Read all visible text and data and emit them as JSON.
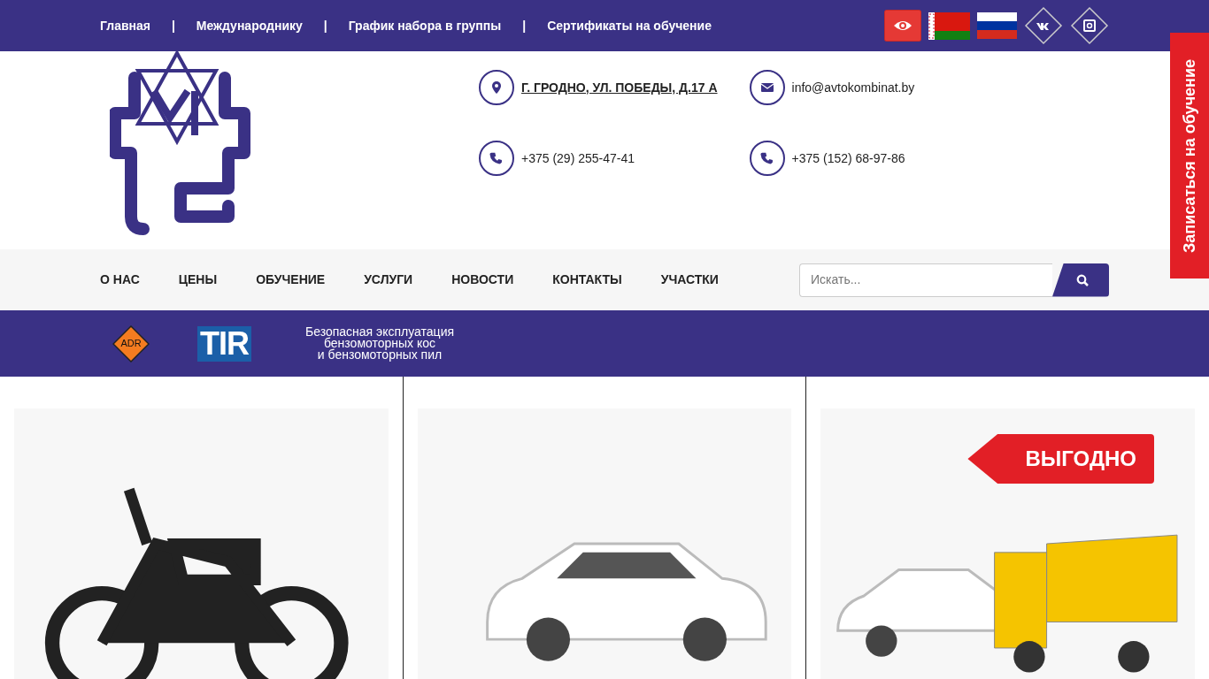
{
  "top_links": [
    "Главная",
    "|",
    "Международнику",
    "|",
    "График набора в группы",
    "|",
    "Сертификаты на обучение"
  ],
  "contacts": [
    {
      "kind": "address",
      "text": "Г. ГРОДНО, УЛ. ПОБЕДЫ, Д.17 А"
    },
    {
      "kind": "email",
      "text": "info@avtokombinat.by"
    },
    {
      "kind": "phone",
      "text": "+375 (29) 255-47-41"
    },
    {
      "kind": "phone",
      "text": "+375 (152) 68-97-86"
    }
  ],
  "menu": [
    "О НАС",
    "ЦЕНЫ",
    "ОБУЧЕНИЕ",
    "УСЛУГИ",
    "НОВОСТИ",
    "КОНТАКТЫ",
    "УЧАСТКИ"
  ],
  "search": {
    "placeholder": "Искать..."
  },
  "banner": {
    "adr": "ADR",
    "tir": "TIR",
    "course": "Безопасная эксплуатация\nбензомоторных кос\nи бензомоторных пил"
  },
  "side_tab": "Записаться на обучение",
  "cards": [
    {
      "kind": "motorcycle"
    },
    {
      "kind": "car"
    },
    {
      "kind": "car-truck",
      "badge": "ВЫГОДНО"
    }
  ]
}
